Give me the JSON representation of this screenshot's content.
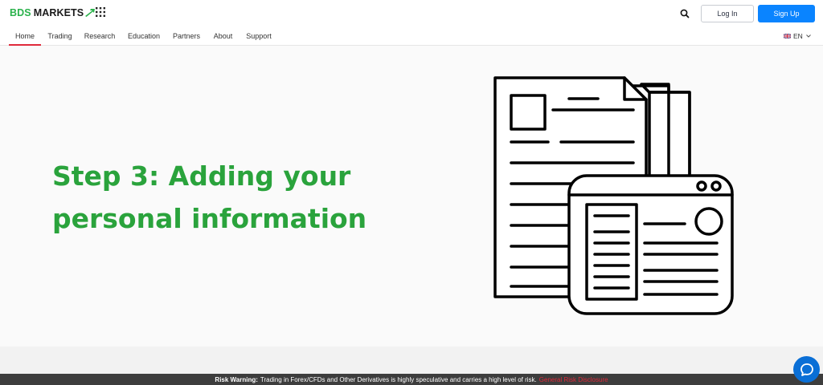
{
  "brand": {
    "name_part1": "BDS",
    "name_part2": "MARKETS",
    "accent": "#2bb24c"
  },
  "header": {
    "apps_icon": "grid-dots-icon",
    "search_icon": "search-icon",
    "login_label": "Log In",
    "signup_label": "Sign Up",
    "signup_color": "#0a84ff"
  },
  "nav": {
    "items": [
      {
        "label": "Home",
        "active": true
      },
      {
        "label": "Trading"
      },
      {
        "label": "Research"
      },
      {
        "label": "Education"
      },
      {
        "label": "Partners"
      },
      {
        "label": "About"
      },
      {
        "label": "Support"
      }
    ],
    "active_color": "#e0293b",
    "language": "EN"
  },
  "hero": {
    "title_line1": "Step 3: Adding your",
    "title_line2": "personal information",
    "title_color": "#2aa33c",
    "illustration": "documents-and-id-card-icon"
  },
  "risk_warning": {
    "label": "Risk Warning:",
    "text": "Trading in Forex/CFDs and Other Derivatives is highly speculative and carries a high level of risk.",
    "link": "General Risk Disclosure"
  },
  "chat": {
    "icon": "chat-bubble-icon",
    "color": "#0a6fd6"
  }
}
